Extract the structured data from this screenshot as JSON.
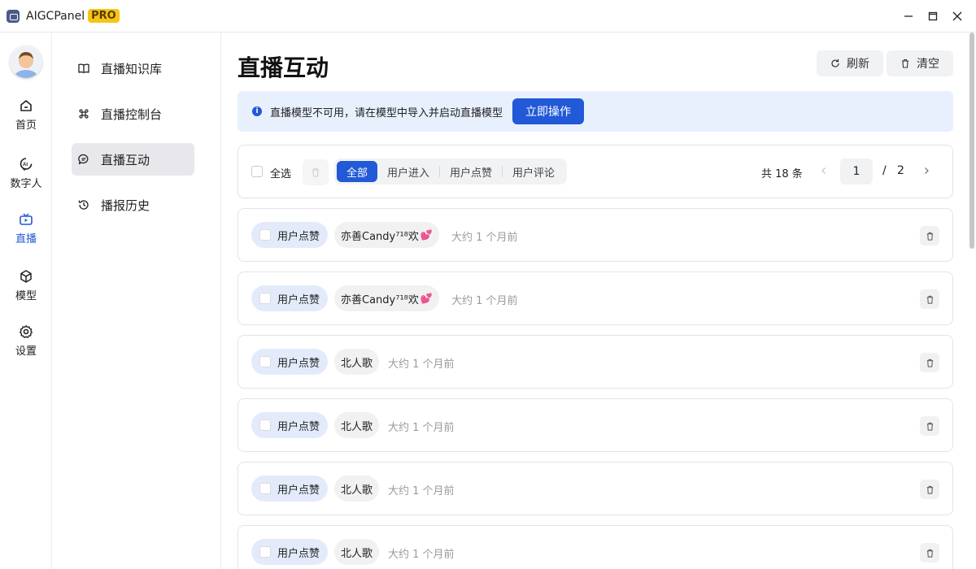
{
  "titlebar": {
    "app_name": "AIGCPanel",
    "badge": "PRO"
  },
  "rail": {
    "items": [
      {
        "label": "首页",
        "icon": "home-icon"
      },
      {
        "label": "数字人",
        "icon": "digital-human-icon"
      },
      {
        "label": "直播",
        "icon": "live-tv-icon"
      },
      {
        "label": "模型",
        "icon": "model-cube-icon"
      },
      {
        "label": "设置",
        "icon": "gear-icon"
      }
    ]
  },
  "subnav": {
    "items": [
      {
        "label": "直播知识库",
        "icon": "book-icon"
      },
      {
        "label": "直播控制台",
        "icon": "command-icon"
      },
      {
        "label": "直播互动",
        "icon": "chat-bubble-icon"
      },
      {
        "label": "播报历史",
        "icon": "history-icon"
      }
    ]
  },
  "page": {
    "title": "直播互动",
    "refresh_label": "刷新",
    "clear_label": "清空"
  },
  "notice": {
    "text": "直播模型不可用，请在模型中导入并启动直播模型",
    "action_label": "立即操作"
  },
  "filter": {
    "select_all": "全选",
    "tabs": [
      "全部",
      "用户进入",
      "用户点赞",
      "用户评论"
    ],
    "active_tab": "全部",
    "total_text": "共 18 条",
    "current_page": "1",
    "page_separator": "/",
    "total_pages": "2"
  },
  "rows": [
    {
      "type": "用户点赞",
      "user": "亦善Candy⁷¹⁸欢",
      "heart": "💕",
      "time": "大约 1 个月前"
    },
    {
      "type": "用户点赞",
      "user": "亦善Candy⁷¹⁸欢",
      "heart": "💕",
      "time": "大约 1 个月前"
    },
    {
      "type": "用户点赞",
      "user": "北人歌",
      "heart": "",
      "time": "大约 1 个月前"
    },
    {
      "type": "用户点赞",
      "user": "北人歌",
      "heart": "",
      "time": "大约 1 个月前"
    },
    {
      "type": "用户点赞",
      "user": "北人歌",
      "heart": "",
      "time": "大约 1 个月前"
    },
    {
      "type": "用户点赞",
      "user": "北人歌",
      "heart": "",
      "time": "大约 1 个月前"
    }
  ],
  "colors": {
    "accent": "#2159d6",
    "notice_bg": "#e8f0fd",
    "badge": "#f5c518"
  }
}
